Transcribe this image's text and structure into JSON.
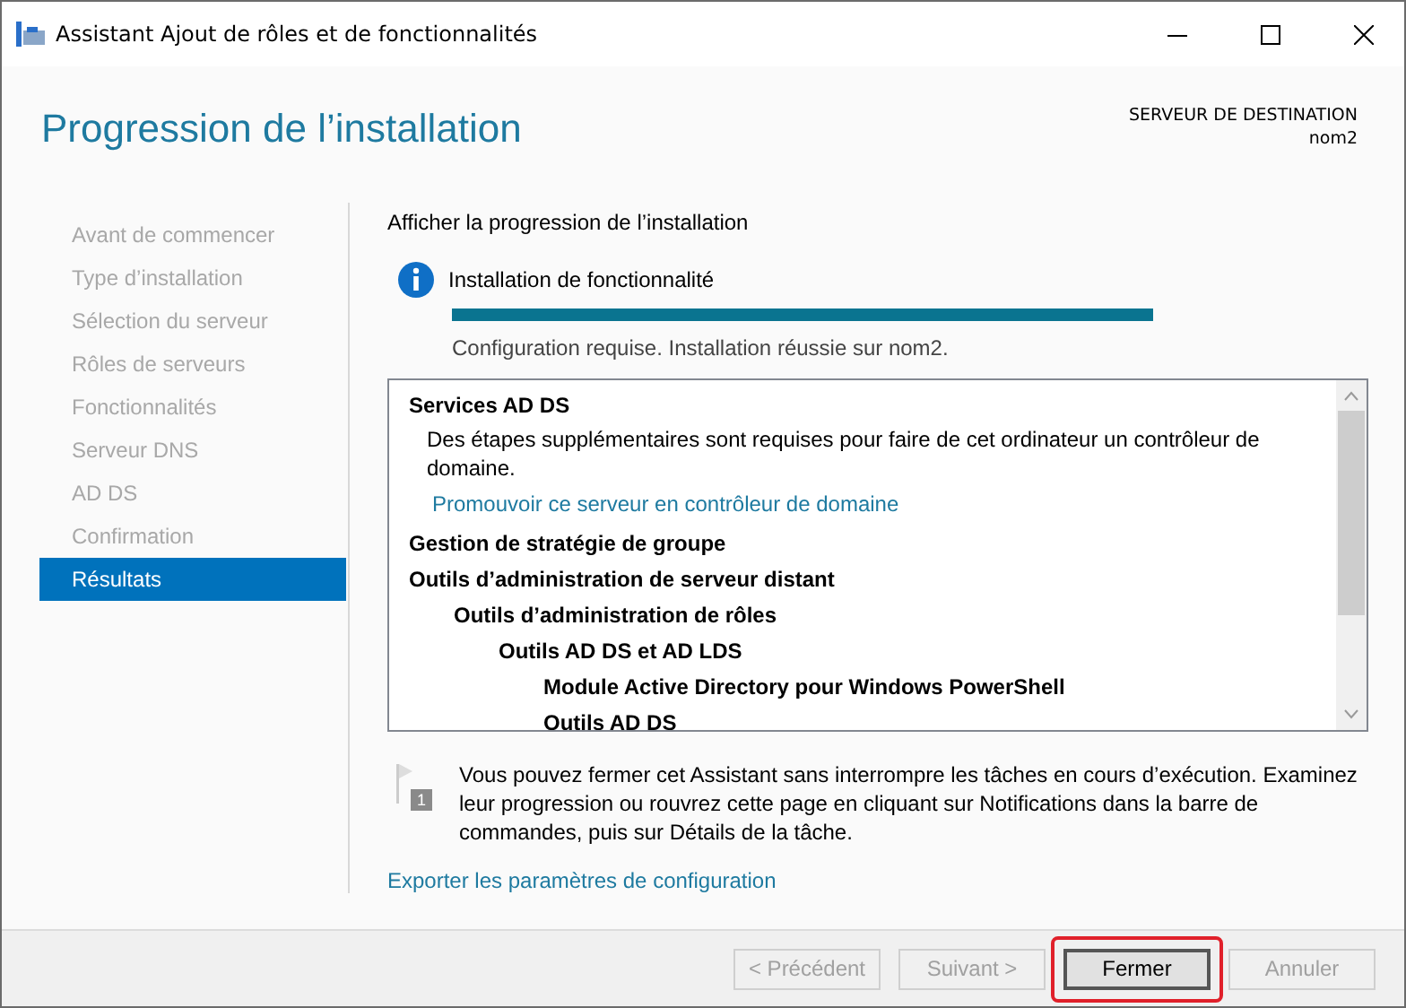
{
  "window": {
    "title": "Assistant Ajout de rôles et de fonctionnalités"
  },
  "header": {
    "title": "Progression de l’installation",
    "destination_label": "SERVEUR DE DESTINATION",
    "destination_server": "nom2"
  },
  "sidebar": {
    "items": [
      {
        "label": "Avant de commencer",
        "selected": false
      },
      {
        "label": "Type d’installation",
        "selected": false
      },
      {
        "label": "Sélection du serveur",
        "selected": false
      },
      {
        "label": "Rôles de serveurs",
        "selected": false
      },
      {
        "label": "Fonctionnalités",
        "selected": false
      },
      {
        "label": "Serveur DNS",
        "selected": false
      },
      {
        "label": "AD DS",
        "selected": false
      },
      {
        "label": "Confirmation",
        "selected": false
      },
      {
        "label": "Résultats",
        "selected": true
      }
    ]
  },
  "content": {
    "heading": "Afficher la progression de l’installation",
    "status_title": "Installation de fonctionnalité",
    "progress": {
      "level": 1
    },
    "status_text": "Configuration requise. Installation réussie sur nom2.",
    "results": [
      {
        "kind": "heading",
        "text": "Services AD DS",
        "children": [
          {
            "kind": "text",
            "text": "Des étapes supplémentaires sont requises pour faire de cet ordinateur un contrôleur de domaine."
          },
          {
            "kind": "link",
            "text": "Promouvoir ce serveur en contrôleur de domaine"
          }
        ]
      },
      {
        "kind": "heading",
        "text": "Gestion de stratégie de groupe"
      },
      {
        "kind": "heading",
        "text": "Outils d’administration de serveur distant",
        "children": [
          {
            "kind": "heading",
            "text": "Outils d’administration de rôles",
            "children": [
              {
                "kind": "heading",
                "text": "Outils AD DS et AD LDS",
                "children": [
                  {
                    "kind": "heading",
                    "text": "Module Active Directory pour Windows PowerShell"
                  },
                  {
                    "kind": "heading",
                    "text": "Outils AD DS"
                  }
                ]
              }
            ]
          }
        ]
      }
    ],
    "note": "Vous pouvez fermer cet Assistant sans interrompre les tâches en cours d’exécution. Examinez leur progression ou rouvrez cette page en cliquant sur Notifications dans la barre de commandes, puis sur Détails de la tâche.",
    "note_badge": "1",
    "export_link": "Exporter les paramètres de configuration"
  },
  "buttons": [
    {
      "label": "< Précédent",
      "disabled": true,
      "highlighted": false
    },
    {
      "label": "Suivant >",
      "disabled": true,
      "highlighted": false
    },
    {
      "label": "Fermer",
      "disabled": false,
      "highlighted": true
    },
    {
      "label": "Annuler",
      "disabled": true,
      "highlighted": false
    }
  ]
}
